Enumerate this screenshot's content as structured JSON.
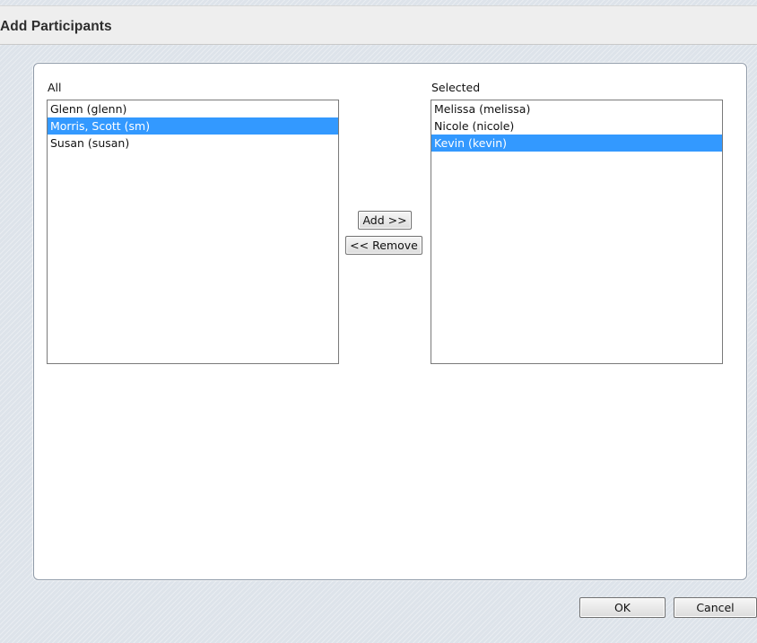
{
  "dialog": {
    "title": "Add Participants"
  },
  "all_list": {
    "label": "All",
    "items": [
      {
        "text": "Glenn (glenn)",
        "selected": false
      },
      {
        "text": "Morris, Scott (sm)",
        "selected": true
      },
      {
        "text": "Susan (susan)",
        "selected": false
      }
    ]
  },
  "selected_list": {
    "label": "Selected",
    "items": [
      {
        "text": "Melissa (melissa)",
        "selected": false
      },
      {
        "text": "Nicole (nicole)",
        "selected": false
      },
      {
        "text": "Kevin (kevin)",
        "selected": true
      }
    ]
  },
  "buttons": {
    "add": "Add >>",
    "remove": "<< Remove",
    "ok": "OK",
    "cancel": "Cancel"
  },
  "colors": {
    "selection": "#3399ff",
    "selection_text": "#ffffff"
  }
}
